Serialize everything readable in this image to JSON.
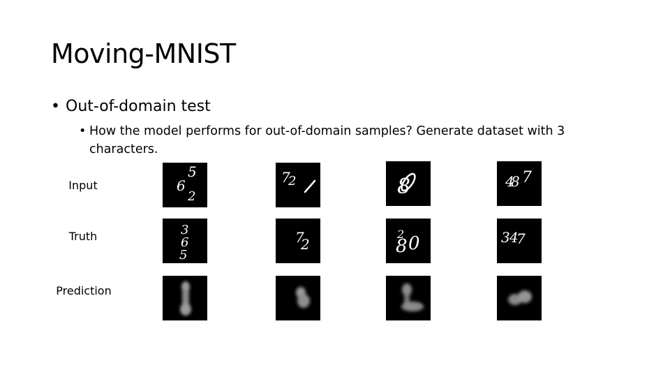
{
  "slide": {
    "title": "Moving-MNIST",
    "bullets": [
      {
        "text": "Out-of-domain test",
        "glyph": "•"
      },
      {
        "text": "How the model performs for out-of-domain samples? Generate dataset with 3 characters.",
        "glyph": "•"
      }
    ]
  },
  "grid": {
    "rows": [
      {
        "label": "Input",
        "samples": [
          {
            "digits": "652",
            "style": "sharp"
          },
          {
            "digits": "721",
            "style": "sharp"
          },
          {
            "digits": "8",
            "style": "sharp"
          },
          {
            "digits": "487",
            "style": "sharp"
          }
        ]
      },
      {
        "label": "Truth",
        "samples": [
          {
            "digits": "365",
            "style": "sharp"
          },
          {
            "digits": "72",
            "style": "sharp"
          },
          {
            "digits": "80",
            "style": "sharp"
          },
          {
            "digits": "347",
            "style": "sharp"
          }
        ]
      },
      {
        "label": "Prediction",
        "samples": [
          {
            "digits": "blurry",
            "style": "blur"
          },
          {
            "digits": "blurry",
            "style": "blur"
          },
          {
            "digits": "blurry",
            "style": "blur"
          },
          {
            "digits": "blurry",
            "style": "blur"
          }
        ]
      }
    ]
  }
}
